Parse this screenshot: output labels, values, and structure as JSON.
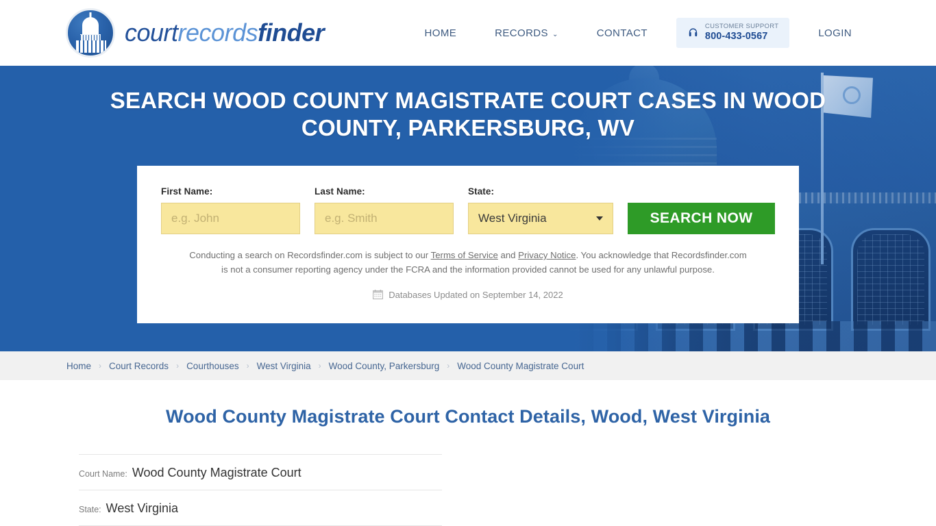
{
  "header": {
    "logo": {
      "icon": "capitol-dome-icon",
      "part1": "court",
      "part2": "records",
      "part3": "finder"
    },
    "nav": [
      {
        "label": "HOME",
        "name": "nav-home"
      },
      {
        "label": "RECORDS",
        "name": "nav-records",
        "caret": "⌄"
      },
      {
        "label": "CONTACT",
        "name": "nav-contact"
      }
    ],
    "support": {
      "icon": "headset-icon",
      "label": "CUSTOMER SUPPORT",
      "phone": "800-433-0567"
    },
    "login": "LOGIN"
  },
  "hero": {
    "title": "SEARCH WOOD COUNTY MAGISTRATE COURT CASES IN WOOD COUNTY, PARKERSBURG, WV",
    "form": {
      "first_name": {
        "label": "First Name:",
        "value": "",
        "placeholder": "e.g. John"
      },
      "last_name": {
        "label": "Last Name:",
        "value": "",
        "placeholder": "e.g. Smith"
      },
      "state": {
        "label": "State:",
        "value": "West Virginia"
      },
      "submit": "SEARCH NOW"
    },
    "disclaimer": {
      "part1": "Conducting a search on Recordsfinder.com is subject to our ",
      "link1": "Terms of Service",
      "mid": " and ",
      "link2": "Privacy Notice",
      "part2": ". You acknowledge that Recordsfinder.com is not a consumer reporting agency under the FCRA and the information provided cannot be used for any unlawful purpose."
    },
    "updated": {
      "icon": "calendar-icon",
      "text": "Databases Updated on September 14, 2022"
    }
  },
  "breadcrumb": {
    "separator": "›",
    "items": [
      "Home",
      "Court Records",
      "Courthouses",
      "West Virginia",
      "Wood County, Parkersburg",
      "Wood County Magistrate Court"
    ]
  },
  "main": {
    "page_title": "Wood County Magistrate Court Contact Details, Wood, West Virginia",
    "details": [
      {
        "label": "Court Name:",
        "value": "Wood County Magistrate Court"
      },
      {
        "label": "State:",
        "value": "West Virginia"
      }
    ]
  },
  "colors": {
    "hero_blue": "#2460aa",
    "brand_blue": "#1f4c93",
    "accent_green": "#2e9b27",
    "input_yellow": "#f8e79d",
    "title_blue": "#2e63a6"
  }
}
